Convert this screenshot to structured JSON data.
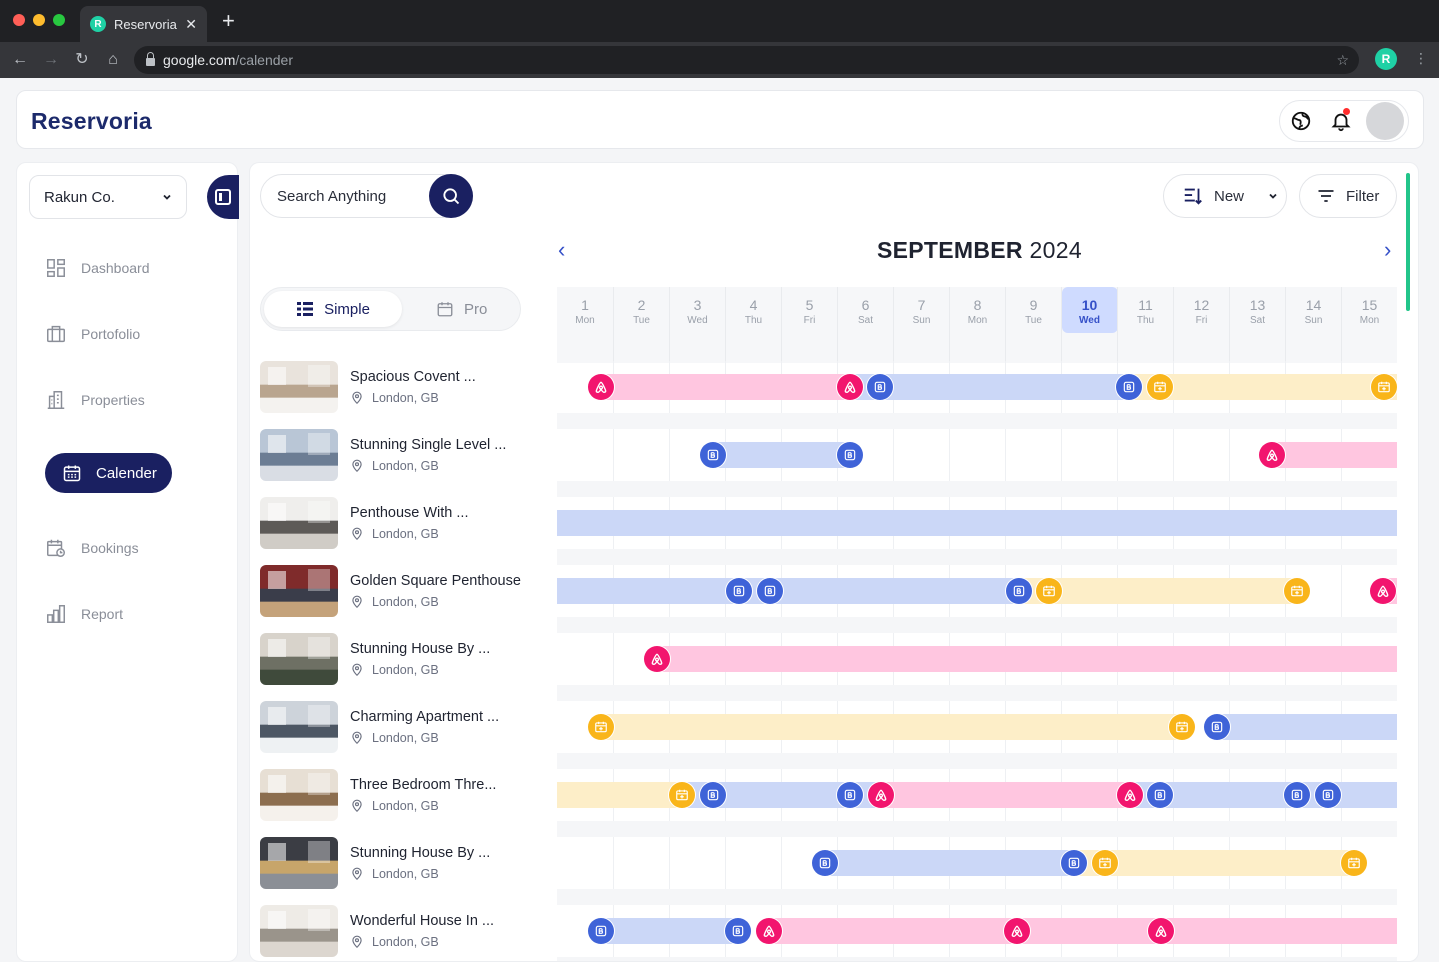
{
  "browser": {
    "tab_title": "Reservoria",
    "url_host": "google.com",
    "url_path": "/calender",
    "lights": [
      "#ff5f57",
      "#febc2e",
      "#28c840"
    ]
  },
  "app": {
    "logo": "Reservoria",
    "brand_color": "#1a2061"
  },
  "sidebar": {
    "company": "Rakun Co.",
    "items": [
      {
        "label": "Dashboard",
        "icon": "dashboard-icon"
      },
      {
        "label": "Portofolio",
        "icon": "briefcase-icon"
      },
      {
        "label": "Properties",
        "icon": "building-icon"
      },
      {
        "label": "Calender",
        "icon": "calendar-icon",
        "active": true
      },
      {
        "label": "Bookings",
        "icon": "calendar-clock-icon"
      },
      {
        "label": "Report",
        "icon": "bar-chart-icon"
      }
    ]
  },
  "toolbar": {
    "search_placeholder": "Search Anything",
    "sort_label": "New",
    "filter_label": "Filter"
  },
  "calendar": {
    "month": "SEPTEMBER",
    "year": "2024",
    "view_simple": "Simple",
    "view_pro": "Pro",
    "days": [
      {
        "n": "1",
        "w": "Mon"
      },
      {
        "n": "2",
        "w": "Tue"
      },
      {
        "n": "3",
        "w": "Wed"
      },
      {
        "n": "4",
        "w": "Thu"
      },
      {
        "n": "5",
        "w": "Fri"
      },
      {
        "n": "6",
        "w": "Sat"
      },
      {
        "n": "7",
        "w": "Sun"
      },
      {
        "n": "8",
        "w": "Mon"
      },
      {
        "n": "9",
        "w": "Tue"
      },
      {
        "n": "10",
        "w": "Wed",
        "today": true
      },
      {
        "n": "11",
        "w": "Thu"
      },
      {
        "n": "12",
        "w": "Fri"
      },
      {
        "n": "13",
        "w": "Sat"
      },
      {
        "n": "14",
        "w": "Sun"
      },
      {
        "n": "15",
        "w": "Mon"
      }
    ],
    "channel_colors": {
      "airbnb": "#f2156e",
      "booking": "#3f63d8",
      "direct": "#f9b51a"
    },
    "properties": [
      {
        "name": "Spacious Covent ...",
        "location": "London, GB"
      },
      {
        "name": "Stunning Single Level ...",
        "location": "London, GB"
      },
      {
        "name": "Penthouse With ...",
        "location": "London, GB"
      },
      {
        "name": "Golden Square Penthouse",
        "location": "London, GB"
      },
      {
        "name": "Stunning House By ...",
        "location": "London, GB"
      },
      {
        "name": "Charming Apartment ...",
        "location": "London, GB"
      },
      {
        "name": "Three Bedroom Thre...",
        "location": "London, GB"
      },
      {
        "name": "Stunning House By ...",
        "location": "London, GB"
      },
      {
        "name": "Wonderful House In ...",
        "location": "London, GB"
      }
    ]
  }
}
